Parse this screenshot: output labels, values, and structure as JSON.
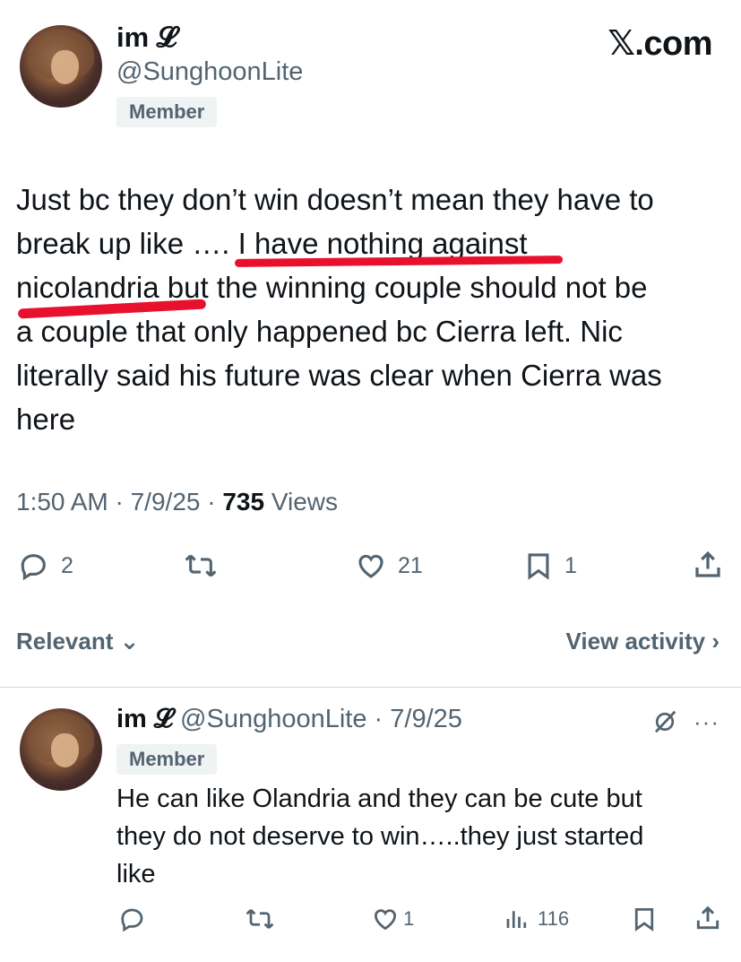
{
  "header": {
    "site_logo": "𝕏.com",
    "author_name": "im 𝓛",
    "author_handle": "@SunghoonLite",
    "badge": "Member"
  },
  "tweet": {
    "text": "Just bc they don’t win doesn’t mean they have to break up like …. I have nothing against nicolandria but the winning couple should not be a couple that only happened bc Cierra left. Nic literally said his future was clear when Cierra was here",
    "lines": [
      "Just bc they don’t win doesn’t mean they have to",
      "break up like …. I have nothing against",
      "nicolandria but the winning couple should not be",
      "a couple that only happened bc Cierra left. Nic",
      "literally said his future was clear when Cierra was",
      "here"
    ],
    "time": "1:50 AM · 7/9/25 · ",
    "views_count": "735",
    "views_label": " Views",
    "replies": "2",
    "likes": "21",
    "bookmarks": "1"
  },
  "sort": {
    "relevant_label": "Relevant ⌄",
    "view_activity_label": "View activity ›"
  },
  "reply": {
    "author_name": "im 𝓛",
    "author_handle": "@SunghoonLite",
    "date": "7/9/25",
    "badge": "Member",
    "lines": [
      "He can like Olandria and they can be cute but",
      "they do not deserve to win…..they just started",
      "like"
    ],
    "likes": "1",
    "views": "116"
  },
  "icons": {
    "reply": "reply-icon",
    "retweet": "retweet-icon",
    "like": "heart-icon",
    "bookmark": "bookmark-icon",
    "share": "share-icon",
    "views": "views-icon",
    "grok": "grok-icon",
    "more": "more-icon"
  },
  "colors": {
    "text": "#0f1419",
    "muted": "#536471",
    "highlight": "#e8112d"
  }
}
